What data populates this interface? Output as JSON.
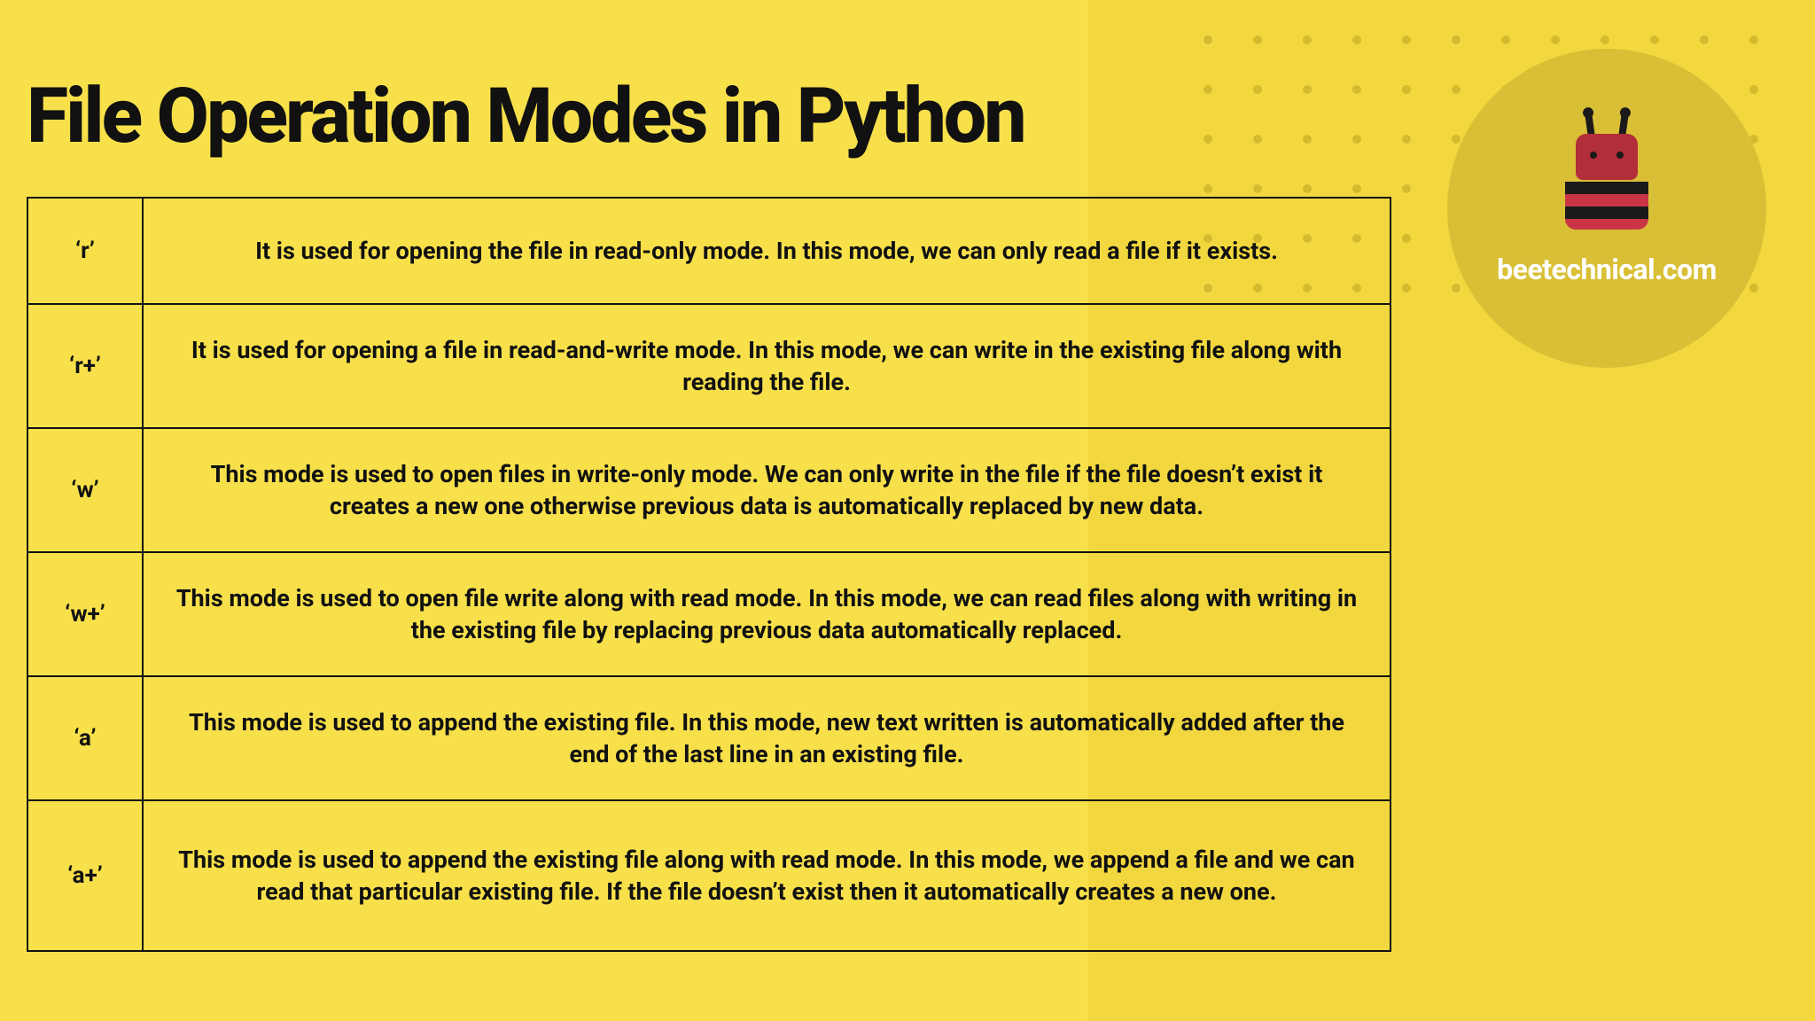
{
  "title": "File Operation Modes in Python",
  "brand": "beetechnical.com",
  "rows": [
    {
      "mode": "‘r’",
      "desc": "It is used for opening the file in read-only mode. In this mode, we can only read a file if it exists."
    },
    {
      "mode": "‘r+’",
      "desc": "It is used for opening a file in read-and-write mode. In this mode, we can write in the existing file along with reading the file."
    },
    {
      "mode": "‘w’",
      "desc": "This mode is used to open files in write-only mode. We can only write in the file if the file doesn’t exist it creates a new one otherwise previous data is automatically replaced by new data."
    },
    {
      "mode": "‘w+’",
      "desc": "This mode is used to open file write along with read mode. In this mode, we can read files along with writing in the existing file by replacing previous data automatically replaced."
    },
    {
      "mode": "‘a’",
      "desc": "This mode is used to append the existing file. In this mode, new text written is automatically added after the end of the last line in an existing file."
    },
    {
      "mode": "‘a+’",
      "desc": "This mode is used to append the existing file along with read mode. In this mode, we append a file and we can read that particular existing file. If the file doesn’t exist then it automatically creates a new one."
    }
  ]
}
